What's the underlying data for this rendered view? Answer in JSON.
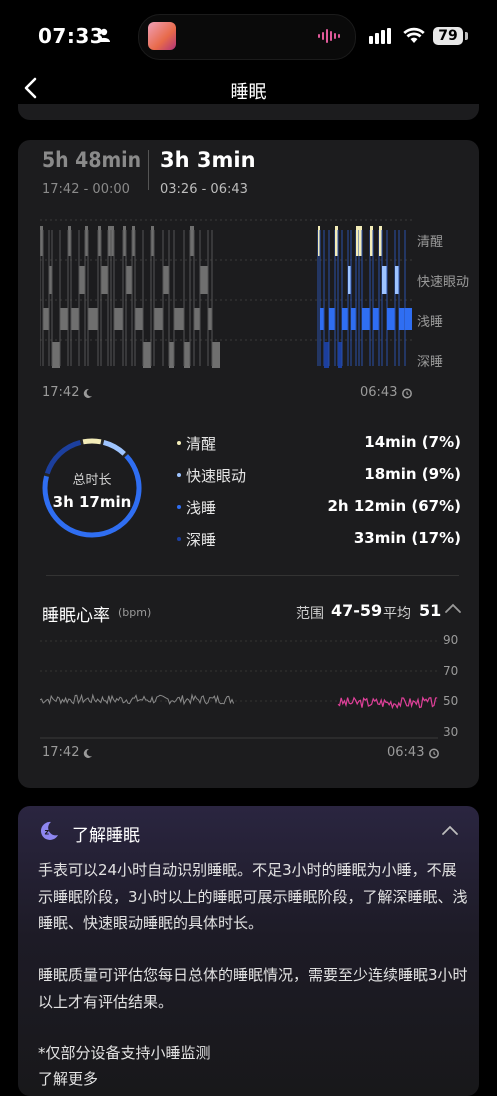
{
  "status_bar": {
    "time": "07:33",
    "battery": "79"
  },
  "nav": {
    "title": "睡眠"
  },
  "segments": [
    {
      "duration": "5h 48min",
      "range": "17:42 - 00:00"
    },
    {
      "duration": "3h 3min",
      "range": "03:26 - 06:43"
    }
  ],
  "stage_chart": {
    "stages": [
      "清醒",
      "快速眼动",
      "浅睡",
      "深睡"
    ],
    "start_time": "17:42",
    "end_time": "06:43"
  },
  "summary": {
    "total_label": "总时长",
    "total_value": "3h 17min",
    "items": [
      {
        "name": "清醒",
        "value": "14min (7%)",
        "color": "#f3ecb8",
        "percent": 7
      },
      {
        "name": "快速眼动",
        "value": "18min (9%)",
        "color": "#9ec4ff",
        "percent": 9
      },
      {
        "name": "浅睡",
        "value": "2h 12min (67%)",
        "color": "#2f6ef2",
        "percent": 67
      },
      {
        "name": "深睡",
        "value": "33min (17%)",
        "color": "#1c3f9e",
        "percent": 17
      }
    ]
  },
  "heart_rate": {
    "title": "睡眠心率",
    "unit": "(bpm)",
    "range_label": "范围",
    "range_value": "47-59",
    "avg_label": "平均",
    "avg_value": "51",
    "y_ticks": [
      "90",
      "70",
      "50",
      "30"
    ],
    "start_time": "17:42",
    "end_time": "06:43"
  },
  "learn": {
    "title": "了解睡眠",
    "paragraphs": [
      "手表可以24小时自动识别睡眠。不足3小时的睡眠为小睡，不展示睡眠阶段，3小时以上的睡眠可展示睡眠阶段，了解深睡眠、浅睡眠、快速眼动睡眠的具体时长。",
      "睡眠质量可评估您每日总体的睡眠情况，需要至少连续睡眠3小时以上才有评估结果。",
      "*仅部分设备支持小睡监测",
      "了解更多"
    ]
  },
  "colors": {
    "awake": "#f3ecb8",
    "rem": "#9ec4ff",
    "light": "#2f6ef2",
    "deep": "#1c3f9e",
    "nap": "#6f6f6f",
    "hr_nap": "#8a8a8a",
    "hr_night": "#e0409a"
  }
}
